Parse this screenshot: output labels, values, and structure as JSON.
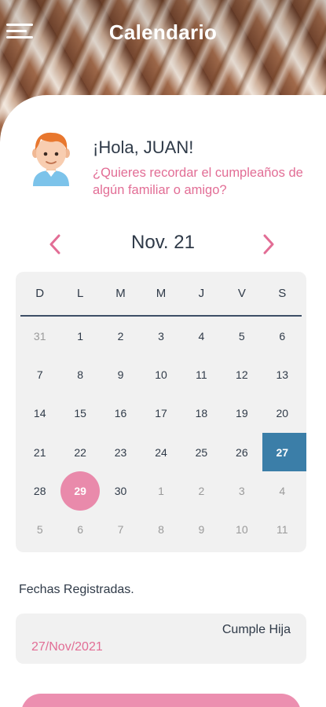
{
  "header": {
    "title": "Calendario",
    "menu_icon": "hamburger-menu-icon"
  },
  "greeting": {
    "hello": "¡Hola, JUAN!",
    "question": "¿Quieres recordar el cumpleaños de algún familiar o amigo?"
  },
  "calendar": {
    "month_label": "Nov. 21",
    "prev_icon": "chevron-left-icon",
    "next_icon": "chevron-right-icon",
    "weekdays": [
      "D",
      "L",
      "M",
      "M",
      "J",
      "V",
      "S"
    ],
    "weeks": [
      [
        {
          "d": "31",
          "m": true
        },
        {
          "d": "1"
        },
        {
          "d": "2"
        },
        {
          "d": "3"
        },
        {
          "d": "4"
        },
        {
          "d": "5"
        },
        {
          "d": "6"
        }
      ],
      [
        {
          "d": "7"
        },
        {
          "d": "8"
        },
        {
          "d": "9"
        },
        {
          "d": "10"
        },
        {
          "d": "11"
        },
        {
          "d": "12"
        },
        {
          "d": "13"
        }
      ],
      [
        {
          "d": "14"
        },
        {
          "d": "15"
        },
        {
          "d": "16"
        },
        {
          "d": "17"
        },
        {
          "d": "18"
        },
        {
          "d": "19"
        },
        {
          "d": "20"
        }
      ],
      [
        {
          "d": "21"
        },
        {
          "d": "22"
        },
        {
          "d": "23"
        },
        {
          "d": "24"
        },
        {
          "d": "25"
        },
        {
          "d": "26"
        },
        {
          "d": "27",
          "s": true
        }
      ],
      [
        {
          "d": "28"
        },
        {
          "d": "29",
          "t": true
        },
        {
          "d": "30"
        },
        {
          "d": "1",
          "m": true
        },
        {
          "d": "2",
          "m": true
        },
        {
          "d": "3",
          "m": true
        },
        {
          "d": "4",
          "m": true
        }
      ],
      [
        {
          "d": "5",
          "m": true
        },
        {
          "d": "6",
          "m": true
        },
        {
          "d": "7",
          "m": true
        },
        {
          "d": "8",
          "m": true
        },
        {
          "d": "9",
          "m": true
        },
        {
          "d": "10",
          "m": true
        },
        {
          "d": "11",
          "m": true
        }
      ]
    ]
  },
  "registered": {
    "title": "Fechas Registradas.",
    "items": [
      {
        "name": "Cumple Hija",
        "date": "27/Nov/2021"
      }
    ]
  },
  "colors": {
    "accent_pink": "#e26d95",
    "selected_blue": "#3b7ea8",
    "text_dark": "#2f3a48"
  }
}
